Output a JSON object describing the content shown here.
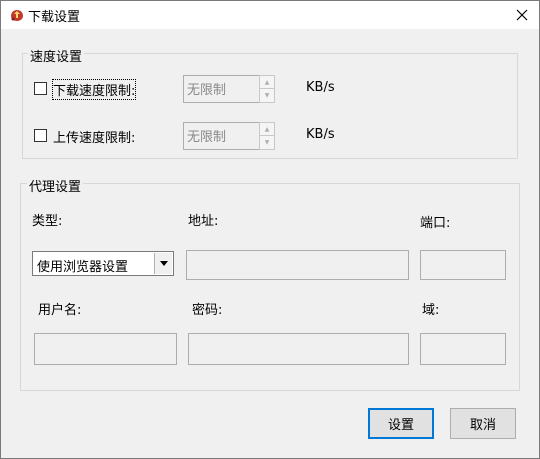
{
  "window": {
    "title": "下载设置"
  },
  "speed": {
    "group_label": "速度设置",
    "download_label": "下载速度限制:",
    "download_value": "无限制",
    "download_unit": "KB/s",
    "upload_label": "上传速度限制:",
    "upload_value": "无限制",
    "upload_unit": "KB/s"
  },
  "proxy": {
    "group_label": "代理设置",
    "type_label": "类型:",
    "type_value": "使用浏览器设置",
    "address_label": "地址:",
    "port_label": "端口:",
    "username_label": "用户名:",
    "password_label": "密码:",
    "domain_label": "域:"
  },
  "buttons": {
    "ok": "设置",
    "cancel": "取消"
  },
  "icons": {
    "app": "app-icon",
    "close": "close-icon",
    "dropdown": "chevron-down-icon"
  },
  "colors": {
    "default_button_border": "#0078d7",
    "disabled_text": "#8a8a8a"
  }
}
